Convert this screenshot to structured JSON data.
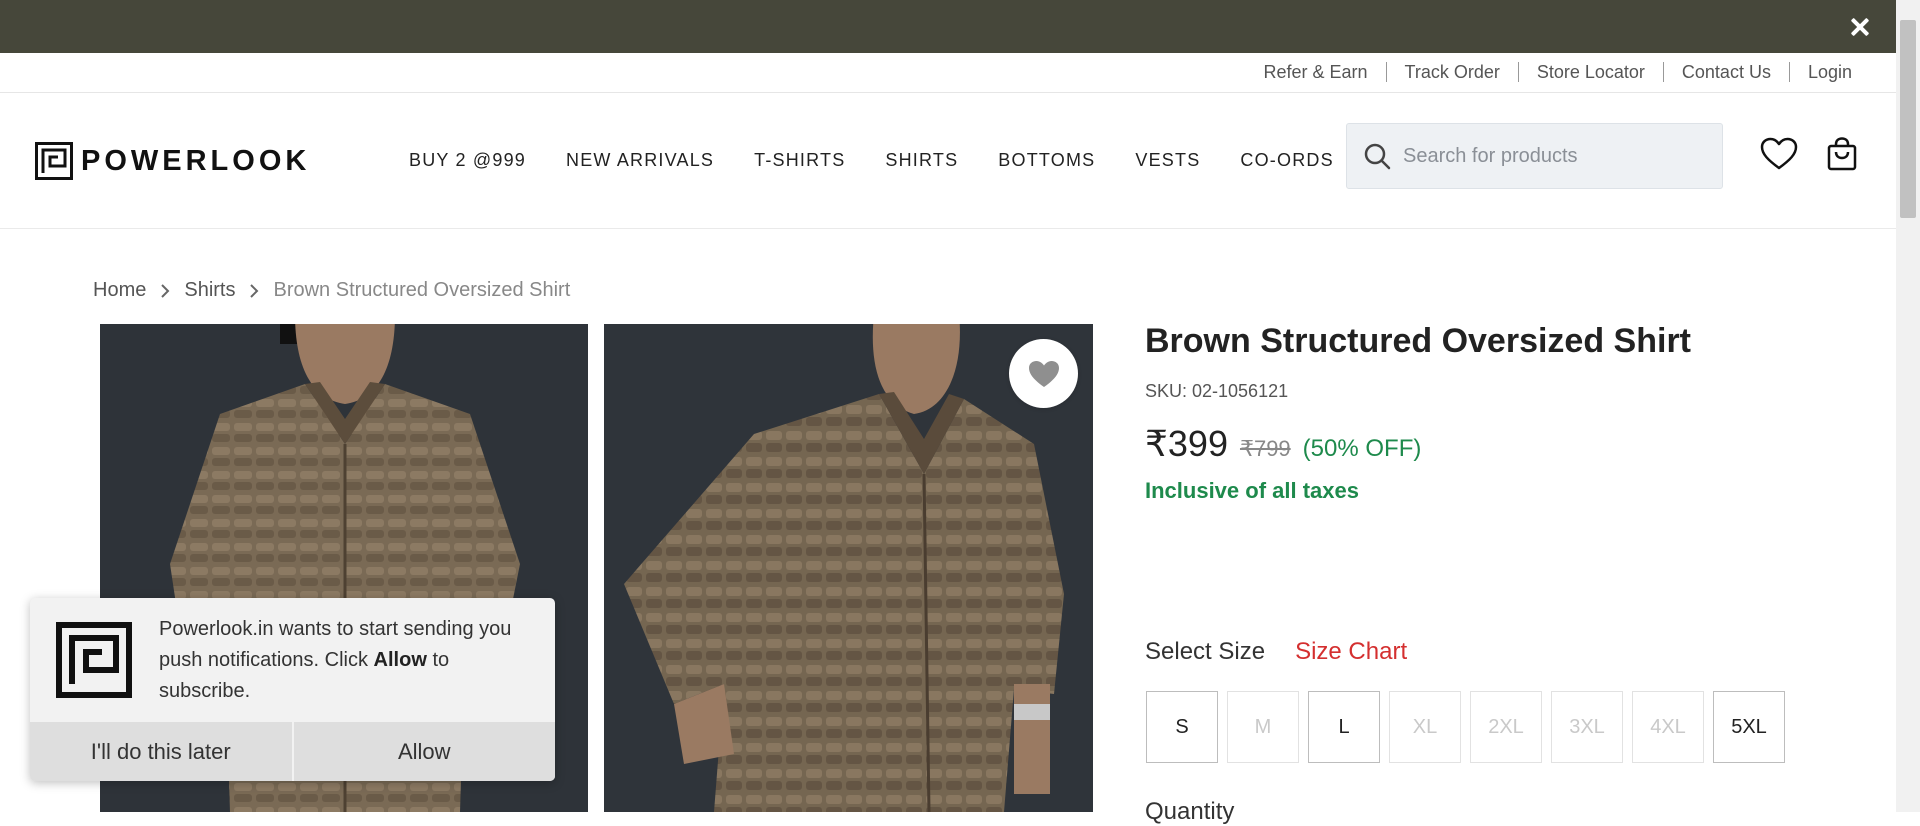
{
  "promo_bar": {
    "close_icon": "close-icon",
    "background": "#46473a"
  },
  "utility_links": [
    "Refer & Earn",
    "Track Order",
    "Store Locator",
    "Contact Us",
    "Login"
  ],
  "header": {
    "logo_text": "POWERLOOK",
    "nav": [
      "BUY 2 @999",
      "NEW ARRIVALS",
      "T-SHIRTS",
      "SHIRTS",
      "BOTTOMS",
      "VESTS",
      "CO-ORDS"
    ],
    "search_placeholder": "Search for products",
    "icons": [
      "search-icon",
      "heart-icon",
      "shopping-bag-icon"
    ]
  },
  "breadcrumb": [
    "Home",
    "Shirts",
    "Brown Structured Oversized Shirt"
  ],
  "gallery": {
    "wishlist_icon": "heart-icon"
  },
  "product": {
    "title": "Brown Structured Oversized Shirt",
    "sku": "SKU: 02-1056121",
    "price": "₹399",
    "mrp": "₹799",
    "discount": "(50% OFF)",
    "tax_note": "Inclusive of all taxes",
    "select_size_label": "Select Size",
    "size_chart_label": "Size Chart",
    "sizes": [
      {
        "label": "S",
        "available": true
      },
      {
        "label": "M",
        "available": false
      },
      {
        "label": "L",
        "available": true
      },
      {
        "label": "XL",
        "available": false
      },
      {
        "label": "2XL",
        "available": false
      },
      {
        "label": "3XL",
        "available": false
      },
      {
        "label": "4XL",
        "available": false
      },
      {
        "label": "5XL",
        "available": true
      }
    ],
    "quantity_label": "Quantity"
  },
  "notification": {
    "message_before": "Powerlook.in wants to start sending you push notifications. Click ",
    "message_bold": "Allow",
    "message_after": " to subscribe.",
    "later_button": "I'll do this later",
    "allow_button": "Allow"
  },
  "colors": {
    "accent_green": "#1e8a4c",
    "size_chart_red": "#d42f2f"
  }
}
